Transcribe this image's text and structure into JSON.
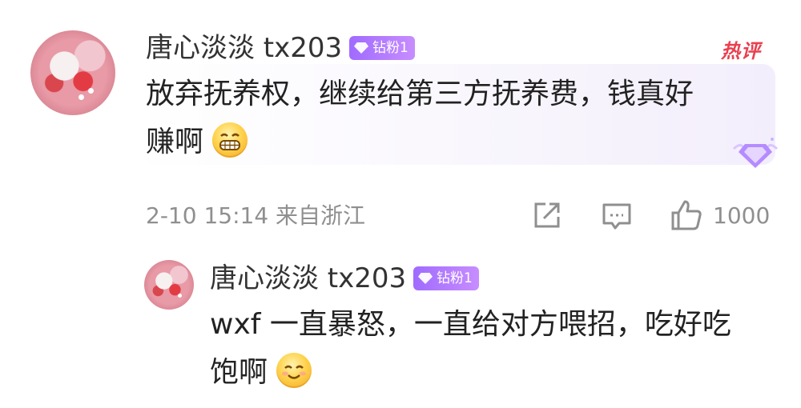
{
  "comment": {
    "username": "唐心淡淡 tx203",
    "badge": "钻粉1",
    "hot_label": "热评",
    "text_line1": "放弃抚养权，继续给第三方抚养费，钱真好",
    "text_line2": "赚啊",
    "emoji": "grin-emoji",
    "meta": "2-10 15:14 来自浙江",
    "like_count": "1000"
  },
  "reply": {
    "username": "唐心淡淡 tx203",
    "badge": "钻粉1",
    "text_line1": "wxf 一直暴怒，一直给对方喂招，吃好吃",
    "text_line2": "饱啊",
    "emoji": "smile-emoji"
  },
  "icons": [
    "share-icon",
    "reply-icon",
    "like-icon",
    "diamond-decoration-icon"
  ],
  "colors": {
    "badge": "#b47dff",
    "hot": "#e9404f",
    "meta": "#8f8f8f"
  }
}
